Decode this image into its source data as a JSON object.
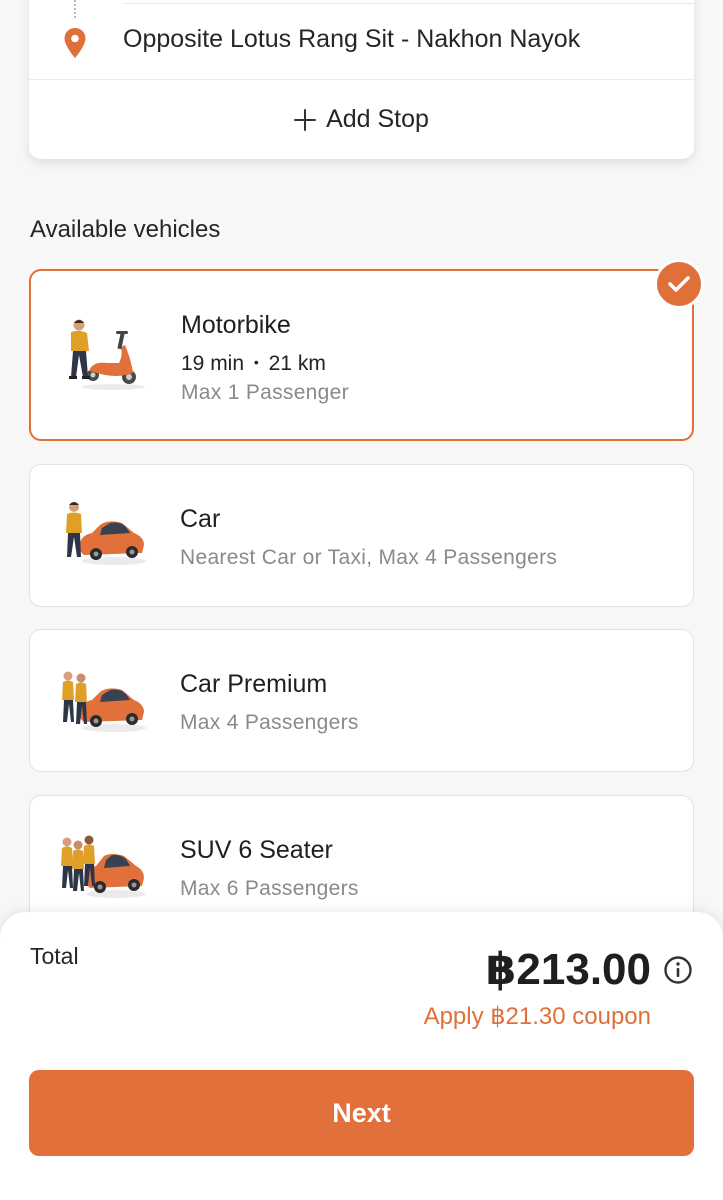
{
  "route": {
    "destination": "Opposite Lotus Rang Sit - Nakhon Nayok",
    "add_stop_label": "Add Stop",
    "pin_icon": "location-pin-icon",
    "accent": "#e0703a"
  },
  "section_title": "Available vehicles",
  "vehicles": [
    {
      "name": "Motorbike",
      "eta": "19 min",
      "distance": "21 km",
      "separator": "•",
      "passengers": "Max 1 Passenger",
      "selected": true,
      "icon": "motorbike-illustration-icon"
    },
    {
      "name": "Car",
      "passengers": "Nearest Car or Taxi, Max 4 Passengers",
      "selected": false,
      "icon": "car-illustration-icon"
    },
    {
      "name": "Car Premium",
      "passengers": "Max 4 Passengers",
      "selected": false,
      "icon": "car-premium-illustration-icon"
    },
    {
      "name": "SUV 6 Seater",
      "passengers": "Max 6 Passengers",
      "selected": false,
      "icon": "suv-illustration-icon"
    }
  ],
  "summary": {
    "total_label": "Total",
    "total_amount": "฿213.00",
    "coupon": "Apply ฿21.30 coupon",
    "next_label": "Next",
    "button_color": "#e2703a"
  }
}
